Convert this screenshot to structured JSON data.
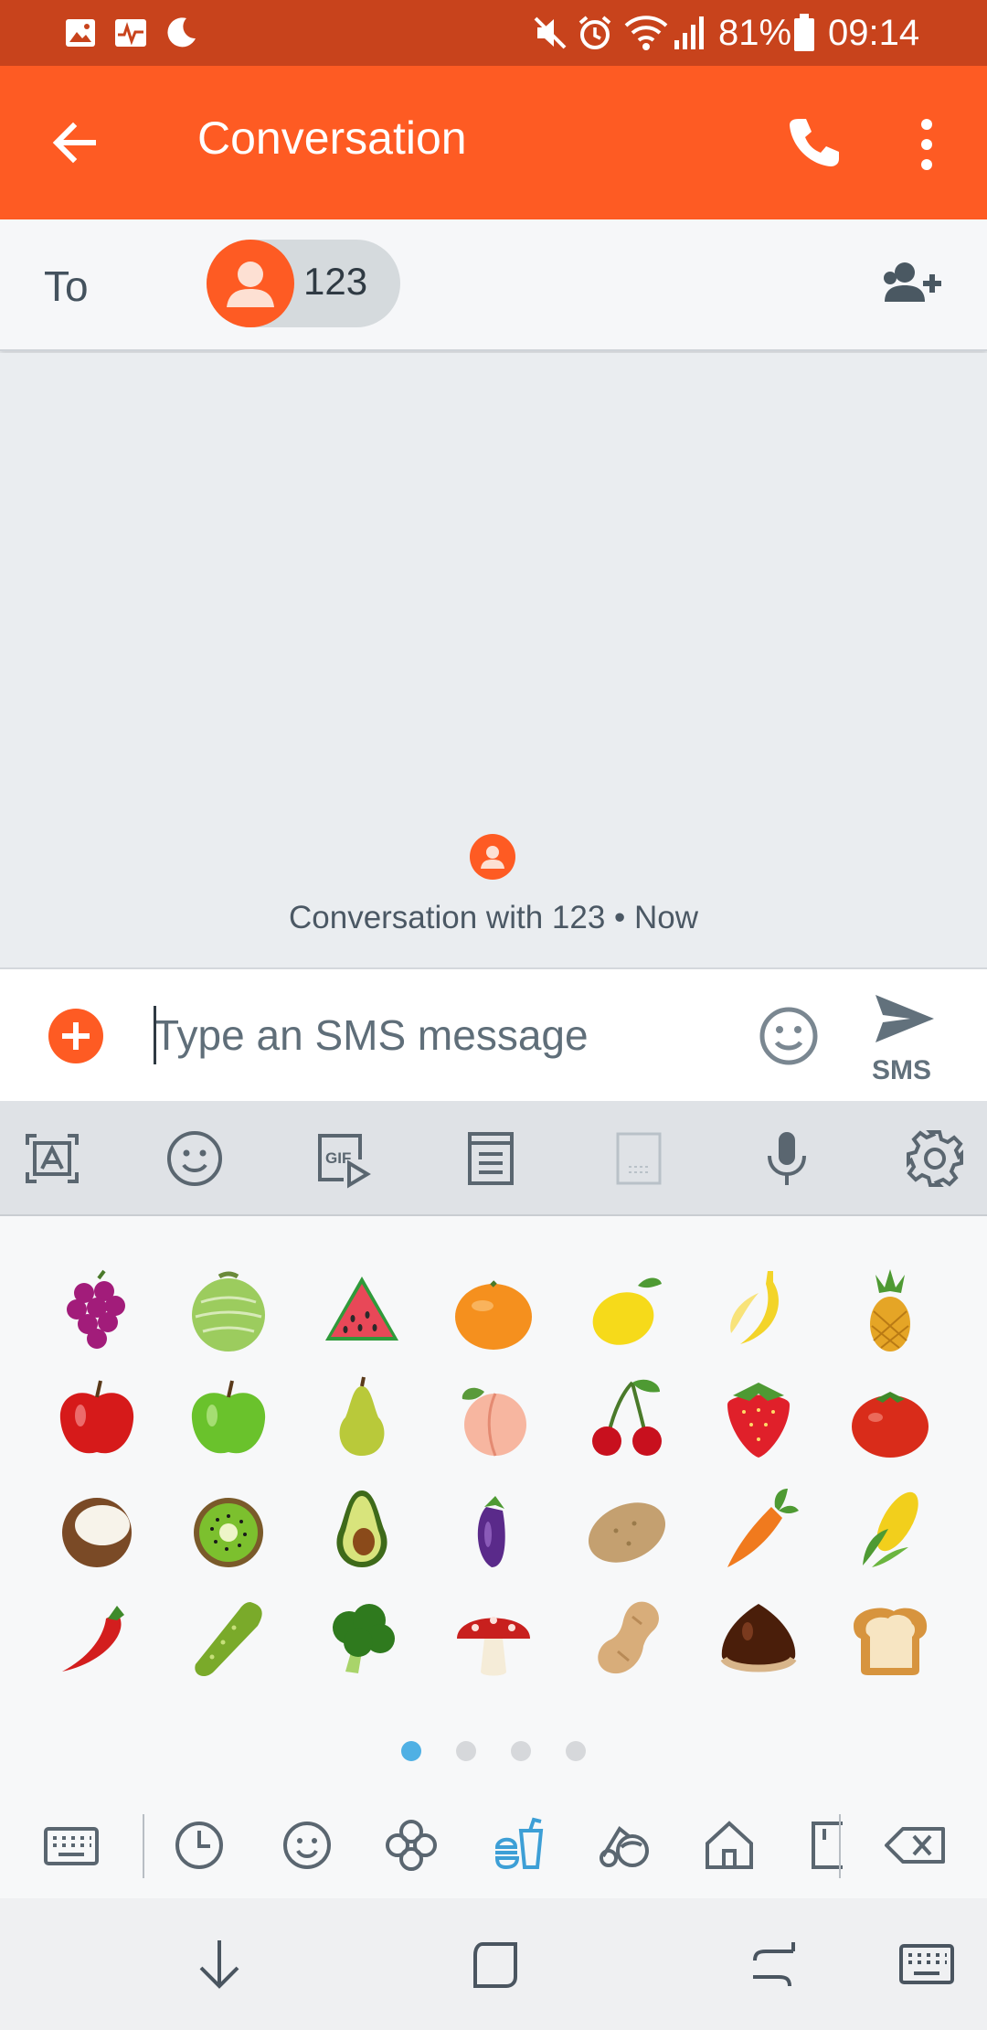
{
  "status_bar": {
    "battery": "81%",
    "time": "09:14",
    "left_icons": [
      "gallery-icon",
      "pulse-icon",
      "moon-icon"
    ],
    "right_icons": [
      "mute-icon",
      "alarm-icon",
      "wifi-icon",
      "signal-icon",
      "battery-icon"
    ]
  },
  "app_bar": {
    "title": "Conversation",
    "icons": [
      "back-arrow-icon",
      "phone-icon",
      "more-vertical-icon"
    ],
    "color": "#fe5b23"
  },
  "recipients": {
    "to_label": "To",
    "chips": [
      {
        "label": "123"
      }
    ],
    "add_icon": "add-contact-icon"
  },
  "conversation": {
    "info": "Conversation with 123 • Now"
  },
  "compose": {
    "placeholder": "Type an SMS message",
    "value": "",
    "send_label": "SMS"
  },
  "keyboard_toolbar": {
    "icons": [
      "text-recognition-icon",
      "emoji-icon",
      "gif-icon",
      "clipboard-icon",
      "handwriting-icon",
      "microphone-icon",
      "settings-icon"
    ]
  },
  "emoji_panel": {
    "rows": [
      [
        "grapes",
        "melon",
        "watermelon",
        "tangerine",
        "lemon",
        "banana",
        "pineapple"
      ],
      [
        "red-apple",
        "green-apple",
        "pear",
        "peach",
        "cherries",
        "strawberry",
        "tomato"
      ],
      [
        "coconut",
        "kiwi",
        "avocado",
        "eggplant",
        "potato",
        "carrot",
        "corn"
      ],
      [
        "hot-pepper",
        "cucumber",
        "broccoli",
        "mushroom",
        "peanuts",
        "chestnut",
        "bread"
      ]
    ],
    "page_count": 4,
    "current_page": 1,
    "categories": [
      "keyboard-icon",
      "recent-icon",
      "smileys-icon",
      "nature-icon",
      "food-icon",
      "activity-icon",
      "places-icon",
      "objects-icon",
      "backspace-icon"
    ],
    "active_category": "food-icon"
  },
  "nav_bar": {
    "icons": [
      "hide-keyboard-icon",
      "recents-icon",
      "back-icon",
      "keyboard-switch-icon"
    ]
  }
}
